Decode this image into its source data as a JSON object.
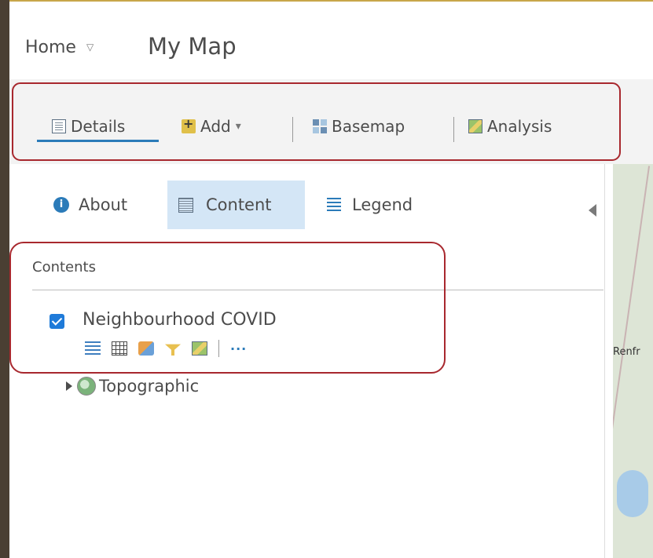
{
  "header": {
    "home_label": "Home",
    "home_caret": "▽",
    "map_title": "My Map"
  },
  "toolbar": {
    "details": "Details",
    "add": "Add",
    "add_caret": "▾",
    "basemap": "Basemap",
    "analysis": "Analysis",
    "accent": "#2b7bb9"
  },
  "panel": {
    "tabs": [
      {
        "label": "About",
        "icon": "info-icon"
      },
      {
        "label": "Content",
        "icon": "content-icon",
        "active": true
      },
      {
        "label": "Legend",
        "icon": "legend-icon"
      }
    ],
    "contents_heading": "Contents",
    "layers": [
      {
        "name": "Neighbourhood COVID",
        "checked": true
      }
    ],
    "layer_tools_more": "···",
    "basemap_name": "Topographic"
  },
  "map": {
    "place_label": "Renfr"
  },
  "colors": {
    "highlight_box": "#a8282e",
    "active_tab_bg": "#d4e6f6",
    "checkbox": "#1f7bd9"
  }
}
